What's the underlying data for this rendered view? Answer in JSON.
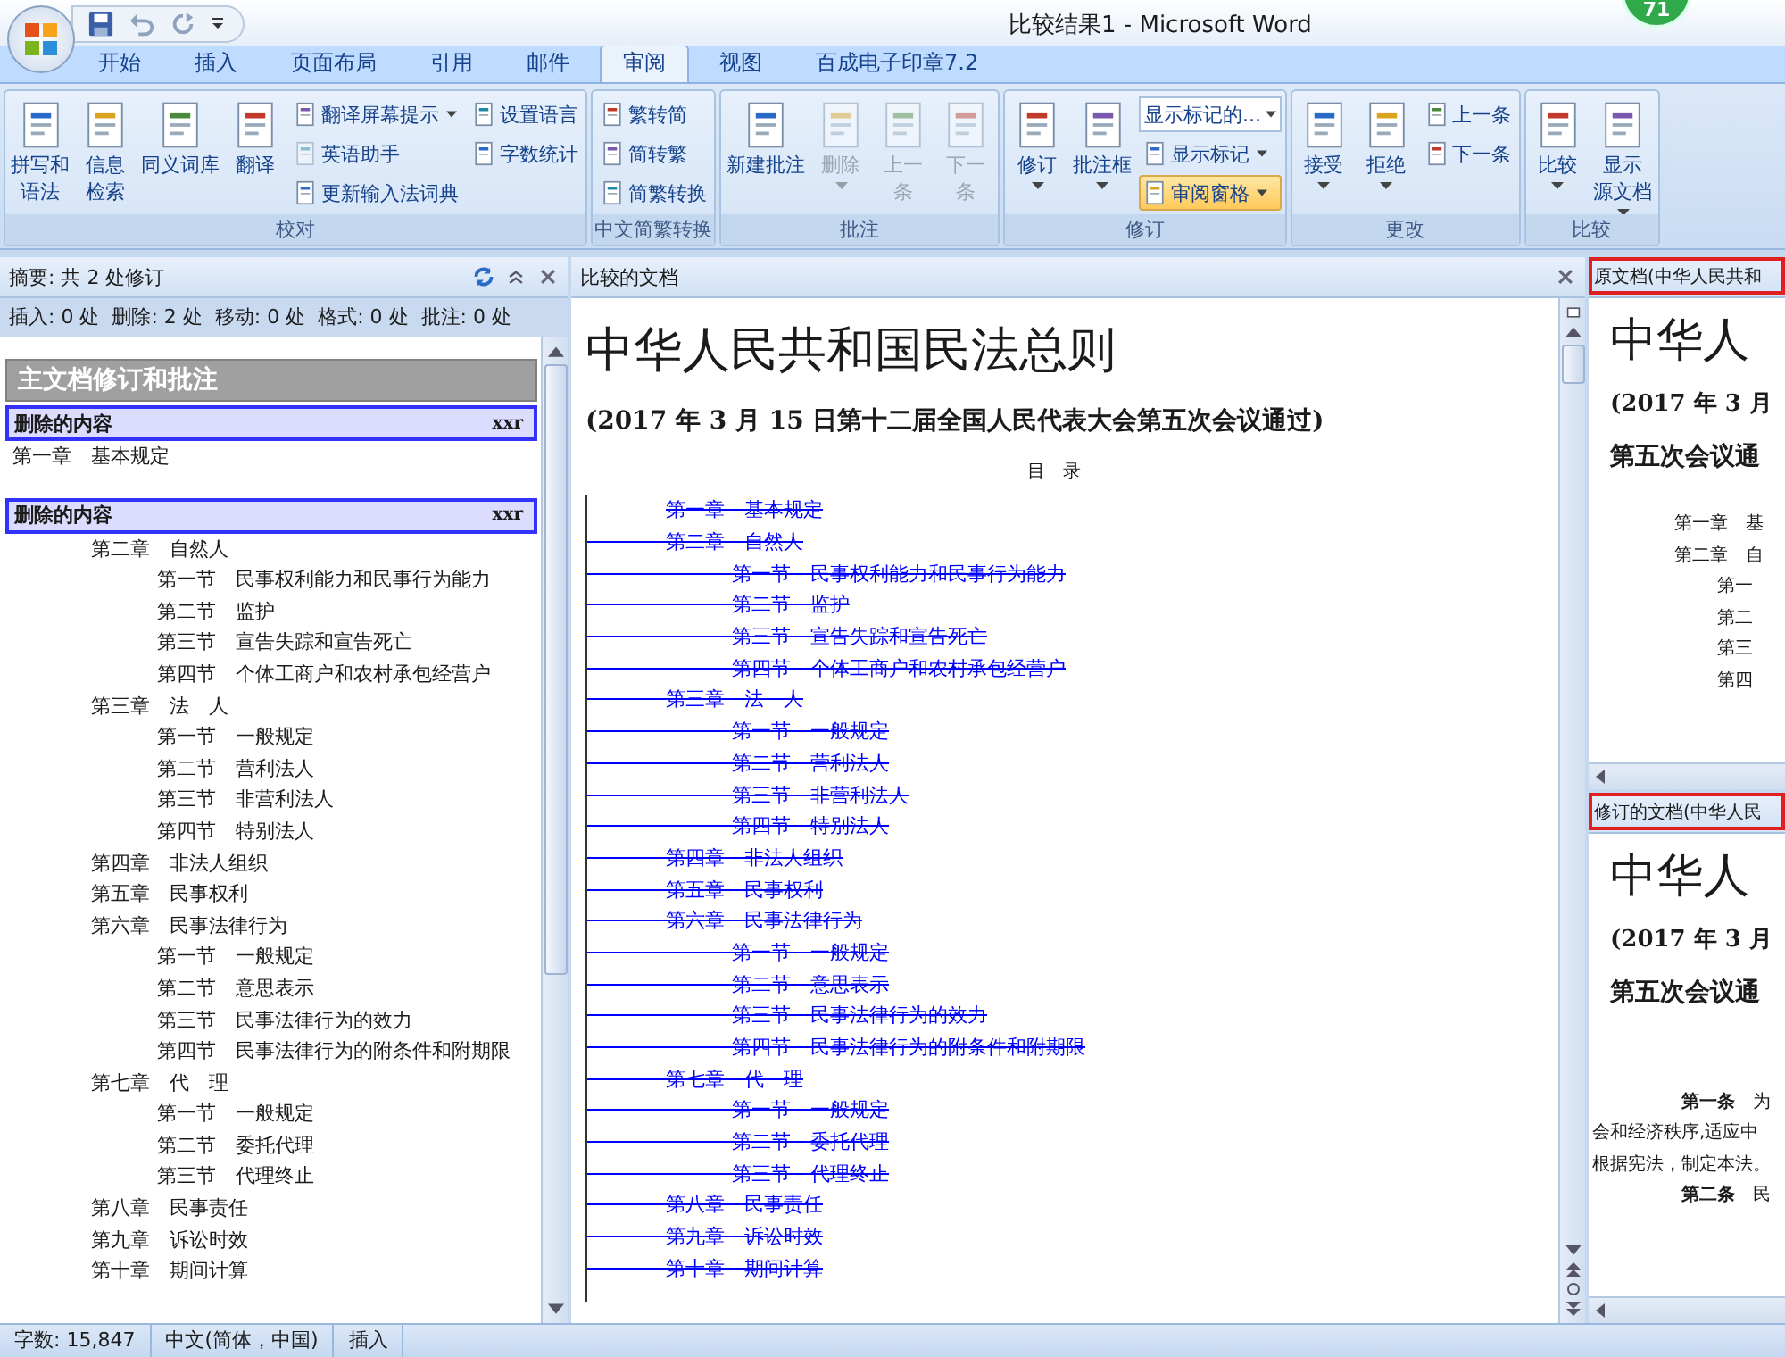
{
  "window": {
    "title": "比较结果1 - Microsoft Word",
    "badge": "71"
  },
  "tabs": [
    {
      "label": "开始",
      "selected": false
    },
    {
      "label": "插入",
      "selected": false
    },
    {
      "label": "页面布局",
      "selected": false
    },
    {
      "label": "引用",
      "selected": false
    },
    {
      "label": "邮件",
      "selected": false
    },
    {
      "label": "审阅",
      "selected": true
    },
    {
      "label": "视图",
      "selected": false
    },
    {
      "label": "百成电子印章7.2",
      "selected": false
    }
  ],
  "ribbon_groups": [
    {
      "label": "校对",
      "items": [
        {
          "kind": "large",
          "label_lines": [
            "拼写和",
            "语法"
          ],
          "caret": false,
          "disabled": false,
          "highlighted": false
        },
        {
          "kind": "large",
          "label_lines": [
            "信息",
            "检索"
          ],
          "caret": false,
          "disabled": false,
          "highlighted": false
        },
        {
          "kind": "large",
          "label_lines": [
            "同义词库"
          ],
          "caret": false,
          "disabled": false,
          "highlighted": false
        },
        {
          "kind": "large",
          "label_lines": [
            "翻译"
          ],
          "caret": false,
          "disabled": false,
          "highlighted": false
        },
        {
          "kind": "stack",
          "items": [
            {
              "kind": "small",
              "label": "翻译屏幕提示",
              "caret": true,
              "disabled": false,
              "highlighted": false
            },
            {
              "kind": "small",
              "label": "英语助手",
              "caret": false,
              "disabled": true,
              "highlighted": false
            },
            {
              "kind": "small",
              "label": "更新输入法词典",
              "caret": false,
              "disabled": false,
              "highlighted": false
            }
          ]
        },
        {
          "kind": "stack",
          "items": [
            {
              "kind": "small",
              "label": "设置语言",
              "caret": false,
              "disabled": false,
              "highlighted": false
            },
            {
              "kind": "small",
              "label": "字数统计",
              "caret": false,
              "disabled": false,
              "highlighted": false
            }
          ]
        }
      ]
    },
    {
      "label": "中文简繁转换",
      "items": [
        {
          "kind": "stack",
          "items": [
            {
              "kind": "small",
              "label": "繁转简",
              "caret": false,
              "disabled": false,
              "highlighted": false
            },
            {
              "kind": "small",
              "label": "简转繁",
              "caret": false,
              "disabled": false,
              "highlighted": false
            },
            {
              "kind": "small",
              "label": "简繁转换",
              "caret": false,
              "disabled": false,
              "highlighted": false
            }
          ]
        }
      ]
    },
    {
      "label": "批注",
      "items": [
        {
          "kind": "large",
          "label_lines": [
            "新建批注"
          ],
          "caret": false,
          "disabled": false,
          "highlighted": false
        },
        {
          "kind": "large",
          "label_lines": [
            "删除"
          ],
          "caret": true,
          "disabled": true,
          "highlighted": false
        },
        {
          "kind": "large",
          "label_lines": [
            "上一",
            "条"
          ],
          "caret": false,
          "disabled": true,
          "highlighted": false
        },
        {
          "kind": "large",
          "label_lines": [
            "下一",
            "条"
          ],
          "caret": false,
          "disabled": true,
          "highlighted": false
        }
      ]
    },
    {
      "label": "修订",
      "items": [
        {
          "kind": "large",
          "label_lines": [
            "修订"
          ],
          "caret": true,
          "disabled": false,
          "highlighted": false
        },
        {
          "kind": "large",
          "label_lines": [
            "批注框"
          ],
          "caret": true,
          "disabled": false,
          "highlighted": false
        },
        {
          "kind": "stack",
          "items": [
            {
              "kind": "dropdown",
              "value": "显示标记的..."
            },
            {
              "kind": "small",
              "label": "显示标记",
              "caret": true,
              "disabled": false,
              "highlighted": false
            },
            {
              "kind": "small",
              "label": "审阅窗格",
              "caret": true,
              "disabled": false,
              "highlighted": true
            }
          ]
        }
      ]
    },
    {
      "label": "更改",
      "items": [
        {
          "kind": "large",
          "label_lines": [
            "接受"
          ],
          "caret": true,
          "disabled": false,
          "highlighted": false
        },
        {
          "kind": "large",
          "label_lines": [
            "拒绝"
          ],
          "caret": true,
          "disabled": false,
          "highlighted": false
        },
        {
          "kind": "stack",
          "items": [
            {
              "kind": "small",
              "label": "上一条",
              "caret": false,
              "disabled": false,
              "highlighted": false
            },
            {
              "kind": "small",
              "label": "下一条",
              "caret": false,
              "disabled": false,
              "highlighted": false
            }
          ]
        }
      ]
    },
    {
      "label": "比较",
      "items": [
        {
          "kind": "large",
          "label_lines": [
            "比较"
          ],
          "caret": true,
          "disabled": false,
          "highlighted": false
        },
        {
          "kind": "large",
          "label_lines": [
            "显示",
            "源文档"
          ],
          "caret": true,
          "disabled": false,
          "highlighted": false
        }
      ]
    }
  ],
  "review_pane": {
    "summary": "摘要: 共 2 处修订",
    "counts": "插入: 0 处  删除: 2 处  移动: 0 处  格式: 0 处  批注: 0 处",
    "section_title": "主文档修订和批注",
    "revisions": [
      {
        "type": "删除的内容",
        "author": "xxr",
        "indented": false,
        "entries": [
          {
            "text": "第一章　基本规定"
          }
        ]
      },
      {
        "type": "删除的内容",
        "author": "xxr",
        "indented": true,
        "entries": [
          {
            "text": "第二章　自然人",
            "children": [
              "第一节　民事权利能力和民事行为能力",
              "第二节　监护",
              "第三节　宣告失踪和宣告死亡",
              "第四节　个体工商户和农村承包经营户"
            ]
          },
          {
            "text": "第三章　法　人",
            "children": [
              "第一节　一般规定",
              "第二节　营利法人",
              "第三节　非营利法人",
              "第四节　特别法人"
            ]
          },
          {
            "text": "第四章　非法人组织"
          },
          {
            "text": "第五章　民事权利"
          },
          {
            "text": "第六章　民事法律行为",
            "children": [
              "第一节　一般规定",
              "第二节　意思表示",
              "第三节　民事法律行为的效力",
              "第四节　民事法律行为的附条件和附期限"
            ]
          },
          {
            "text": "第七章　代　理",
            "children": [
              "第一节　一般规定",
              "第二节　委托代理",
              "第三节　代理终止"
            ]
          },
          {
            "text": "第八章　民事责任"
          },
          {
            "text": "第九章　诉讼时效"
          },
          {
            "text": "第十章　期间计算"
          }
        ]
      }
    ]
  },
  "compared_document": {
    "header": "比较的文档",
    "title": "中华人民共和国民法总则",
    "subtitle": "(2017 年 3 月 15 日第十二届全国人民代表大会第五次会议通过)",
    "toc_heading": "目　录",
    "toc": [
      {
        "text": "第一章　基本规定",
        "deleted": true
      },
      {
        "text": "第二章　自然人",
        "deleted": true,
        "children": [
          {
            "text": "第一节　民事权利能力和民事行为能力",
            "deleted": true
          },
          {
            "text": "第二节　监护",
            "deleted": true
          },
          {
            "text": "第三节　宣告失踪和宣告死亡",
            "deleted": true
          },
          {
            "text": "第四节　个体工商户和农村承包经营户",
            "deleted": true
          }
        ]
      },
      {
        "text": "第三章　法　人",
        "deleted": true,
        "children": [
          {
            "text": "第一节　一般规定",
            "deleted": true
          },
          {
            "text": "第二节　营利法人",
            "deleted": true
          },
          {
            "text": "第三节　非营利法人",
            "deleted": true
          },
          {
            "text": "第四节　特别法人",
            "deleted": true
          }
        ]
      },
      {
        "text": "第四章　非法人组织",
        "deleted": true
      },
      {
        "text": "第五章　民事权利",
        "deleted": true
      },
      {
        "text": "第六章　民事法律行为",
        "deleted": true,
        "children": [
          {
            "text": "第一节　一般规定",
            "deleted": true
          },
          {
            "text": "第二节　意思表示",
            "deleted": true
          },
          {
            "text": "第三节　民事法律行为的效力",
            "deleted": true
          },
          {
            "text": "第四节　民事法律行为的附条件和附期限",
            "deleted": true
          }
        ]
      },
      {
        "text": "第七章　代　理",
        "deleted": true,
        "children": [
          {
            "text": "第一节　一般规定",
            "deleted": true
          },
          {
            "text": "第二节　委托代理",
            "deleted": true
          },
          {
            "text": "第三节　代理终止",
            "deleted": true
          }
        ]
      },
      {
        "text": "第八章　民事责任",
        "deleted": true
      },
      {
        "text": "第九章　诉讼时效",
        "deleted": true
      },
      {
        "text": "第十章　期间计算",
        "deleted": true
      }
    ]
  },
  "source_panes": [
    {
      "header": "原文档(中华人民共和",
      "highlighted": true,
      "title": "中华人",
      "subtitle": "(2017 年 3 月",
      "subtitle_2": "第五次会议通",
      "lines": [
        {
          "kind": "chapter",
          "text": "第一章　基"
        },
        {
          "kind": "chapter",
          "text": "第二章　自"
        },
        {
          "kind": "section",
          "text": "第一"
        },
        {
          "kind": "section",
          "text": "第二"
        },
        {
          "kind": "section",
          "text": "第三"
        },
        {
          "kind": "section",
          "text": "第四"
        }
      ]
    },
    {
      "header": "修订的文档(中华人民",
      "highlighted": true,
      "title": "中华人",
      "subtitle": "(2017 年 3 月",
      "subtitle_2": "第五次会议通",
      "lines": [
        {
          "kind": "article",
          "text": "**第一条**　为"
        },
        {
          "kind": "body",
          "text": "会和经济秩序,适应中"
        },
        {
          "kind": "body",
          "text": "根据宪法，制定本法。"
        },
        {
          "kind": "article",
          "text": "**第二条**　民"
        }
      ]
    }
  ],
  "status_bar": [
    "字数: 15,847",
    "中文(简体，中国)",
    "插入"
  ]
}
